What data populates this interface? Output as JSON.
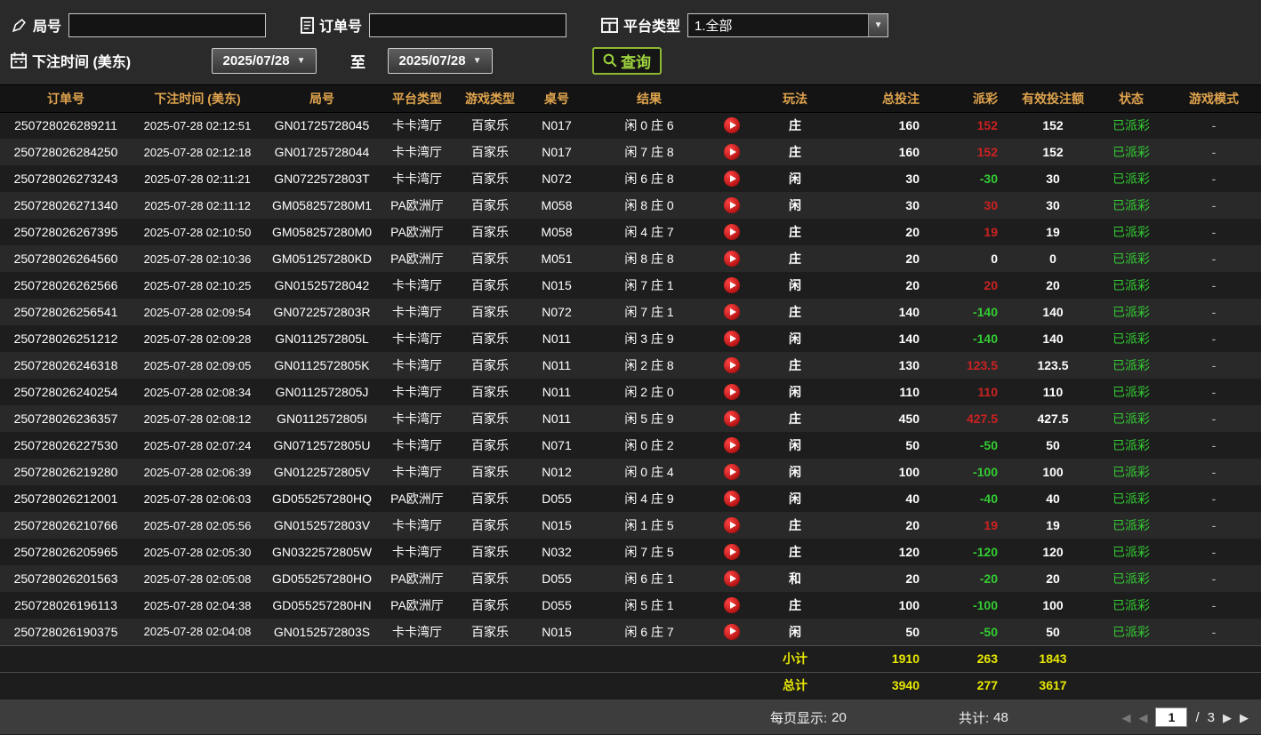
{
  "filters": {
    "round": {
      "label": "局号",
      "value": ""
    },
    "order": {
      "label": "订单号",
      "value": ""
    },
    "platform": {
      "label": "平台类型",
      "value": "1.全部"
    },
    "bet_time": {
      "label": "下注时间 (美东)",
      "from": "2025/07/28",
      "to_label": "至",
      "to": "2025/07/28"
    },
    "query_button": "查询"
  },
  "table": {
    "headers": [
      "订单号",
      "下注时间 (美东)",
      "局号",
      "平台类型",
      "游戏类型",
      "桌号",
      "结果",
      "",
      "玩法",
      "总投注",
      "派彩",
      "有效投注额",
      "状态",
      "游戏模式"
    ],
    "rows": [
      {
        "order_id": "250728026289211",
        "bet_time": "2025-07-28 02:12:51",
        "round_no": "GN01725728045",
        "platform": "卡卡湾厅",
        "game_type": "百家乐",
        "table_no": "N017",
        "result": "闲 0 庄 6",
        "bet_type": "庄",
        "total_bet": "160",
        "payout": "152",
        "payout_color": "win",
        "valid_bet": "152",
        "status": "已派彩",
        "game_mode": "-"
      },
      {
        "order_id": "250728026284250",
        "bet_time": "2025-07-28 02:12:18",
        "round_no": "GN01725728044",
        "platform": "卡卡湾厅",
        "game_type": "百家乐",
        "table_no": "N017",
        "result": "闲 7 庄 8",
        "bet_type": "庄",
        "total_bet": "160",
        "payout": "152",
        "payout_color": "win",
        "valid_bet": "152",
        "status": "已派彩",
        "game_mode": "-"
      },
      {
        "order_id": "250728026273243",
        "bet_time": "2025-07-28 02:11:21",
        "round_no": "GN0722572803T",
        "platform": "卡卡湾厅",
        "game_type": "百家乐",
        "table_no": "N072",
        "result": "闲 6 庄 8",
        "bet_type": "闲",
        "total_bet": "30",
        "payout": "-30",
        "payout_color": "loss",
        "valid_bet": "30",
        "status": "已派彩",
        "game_mode": "-"
      },
      {
        "order_id": "250728026271340",
        "bet_time": "2025-07-28 02:11:12",
        "round_no": "GM058257280M1",
        "platform": "PA欧洲厅",
        "game_type": "百家乐",
        "table_no": "M058",
        "result": "闲 8 庄 0",
        "bet_type": "闲",
        "total_bet": "30",
        "payout": "30",
        "payout_color": "win",
        "valid_bet": "30",
        "status": "已派彩",
        "game_mode": "-"
      },
      {
        "order_id": "250728026267395",
        "bet_time": "2025-07-28 02:10:50",
        "round_no": "GM058257280M0",
        "platform": "PA欧洲厅",
        "game_type": "百家乐",
        "table_no": "M058",
        "result": "闲 4 庄 7",
        "bet_type": "庄",
        "total_bet": "20",
        "payout": "19",
        "payout_color": "win",
        "valid_bet": "19",
        "status": "已派彩",
        "game_mode": "-"
      },
      {
        "order_id": "250728026264560",
        "bet_time": "2025-07-28 02:10:36",
        "round_no": "GM051257280KD",
        "platform": "PA欧洲厅",
        "game_type": "百家乐",
        "table_no": "M051",
        "result": "闲 8 庄 8",
        "bet_type": "庄",
        "total_bet": "20",
        "payout": "0",
        "payout_color": "zero",
        "valid_bet": "0",
        "status": "已派彩",
        "game_mode": "-"
      },
      {
        "order_id": "250728026262566",
        "bet_time": "2025-07-28 02:10:25",
        "round_no": "GN01525728042",
        "platform": "卡卡湾厅",
        "game_type": "百家乐",
        "table_no": "N015",
        "result": "闲 7 庄 1",
        "bet_type": "闲",
        "total_bet": "20",
        "payout": "20",
        "payout_color": "win",
        "valid_bet": "20",
        "status": "已派彩",
        "game_mode": "-"
      },
      {
        "order_id": "250728026256541",
        "bet_time": "2025-07-28 02:09:54",
        "round_no": "GN0722572803R",
        "platform": "卡卡湾厅",
        "game_type": "百家乐",
        "table_no": "N072",
        "result": "闲 7 庄 1",
        "bet_type": "庄",
        "total_bet": "140",
        "payout": "-140",
        "payout_color": "loss",
        "valid_bet": "140",
        "status": "已派彩",
        "game_mode": "-"
      },
      {
        "order_id": "250728026251212",
        "bet_time": "2025-07-28 02:09:28",
        "round_no": "GN0112572805L",
        "platform": "卡卡湾厅",
        "game_type": "百家乐",
        "table_no": "N011",
        "result": "闲 3 庄 9",
        "bet_type": "闲",
        "total_bet": "140",
        "payout": "-140",
        "payout_color": "loss",
        "valid_bet": "140",
        "status": "已派彩",
        "game_mode": "-"
      },
      {
        "order_id": "250728026246318",
        "bet_time": "2025-07-28 02:09:05",
        "round_no": "GN0112572805K",
        "platform": "卡卡湾厅",
        "game_type": "百家乐",
        "table_no": "N011",
        "result": "闲 2 庄 8",
        "bet_type": "庄",
        "total_bet": "130",
        "payout": "123.5",
        "payout_color": "win",
        "valid_bet": "123.5",
        "status": "已派彩",
        "game_mode": "-"
      },
      {
        "order_id": "250728026240254",
        "bet_time": "2025-07-28 02:08:34",
        "round_no": "GN0112572805J",
        "platform": "卡卡湾厅",
        "game_type": "百家乐",
        "table_no": "N011",
        "result": "闲 2 庄 0",
        "bet_type": "闲",
        "total_bet": "110",
        "payout": "110",
        "payout_color": "win",
        "valid_bet": "110",
        "status": "已派彩",
        "game_mode": "-"
      },
      {
        "order_id": "250728026236357",
        "bet_time": "2025-07-28 02:08:12",
        "round_no": "GN0112572805I",
        "platform": "卡卡湾厅",
        "game_type": "百家乐",
        "table_no": "N011",
        "result": "闲 5 庄 9",
        "bet_type": "庄",
        "total_bet": "450",
        "payout": "427.5",
        "payout_color": "win",
        "valid_bet": "427.5",
        "status": "已派彩",
        "game_mode": "-"
      },
      {
        "order_id": "250728026227530",
        "bet_time": "2025-07-28 02:07:24",
        "round_no": "GN0712572805U",
        "platform": "卡卡湾厅",
        "game_type": "百家乐",
        "table_no": "N071",
        "result": "闲 0 庄 2",
        "bet_type": "闲",
        "total_bet": "50",
        "payout": "-50",
        "payout_color": "loss",
        "valid_bet": "50",
        "status": "已派彩",
        "game_mode": "-"
      },
      {
        "order_id": "250728026219280",
        "bet_time": "2025-07-28 02:06:39",
        "round_no": "GN0122572805V",
        "platform": "卡卡湾厅",
        "game_type": "百家乐",
        "table_no": "N012",
        "result": "闲 0 庄 4",
        "bet_type": "闲",
        "total_bet": "100",
        "payout": "-100",
        "payout_color": "loss",
        "valid_bet": "100",
        "status": "已派彩",
        "game_mode": "-"
      },
      {
        "order_id": "250728026212001",
        "bet_time": "2025-07-28 02:06:03",
        "round_no": "GD055257280HQ",
        "platform": "PA欧洲厅",
        "game_type": "百家乐",
        "table_no": "D055",
        "result": "闲 4 庄 9",
        "bet_type": "闲",
        "total_bet": "40",
        "payout": "-40",
        "payout_color": "loss",
        "valid_bet": "40",
        "status": "已派彩",
        "game_mode": "-"
      },
      {
        "order_id": "250728026210766",
        "bet_time": "2025-07-28 02:05:56",
        "round_no": "GN0152572803V",
        "platform": "卡卡湾厅",
        "game_type": "百家乐",
        "table_no": "N015",
        "result": "闲 1 庄 5",
        "bet_type": "庄",
        "total_bet": "20",
        "payout": "19",
        "payout_color": "win",
        "valid_bet": "19",
        "status": "已派彩",
        "game_mode": "-"
      },
      {
        "order_id": "250728026205965",
        "bet_time": "2025-07-28 02:05:30",
        "round_no": "GN0322572805W",
        "platform": "卡卡湾厅",
        "game_type": "百家乐",
        "table_no": "N032",
        "result": "闲 7 庄 5",
        "bet_type": "庄",
        "total_bet": "120",
        "payout": "-120",
        "payout_color": "loss",
        "valid_bet": "120",
        "status": "已派彩",
        "game_mode": "-"
      },
      {
        "order_id": "250728026201563",
        "bet_time": "2025-07-28 02:05:08",
        "round_no": "GD055257280HO",
        "platform": "PA欧洲厅",
        "game_type": "百家乐",
        "table_no": "D055",
        "result": "闲 6 庄 1",
        "bet_type": "和",
        "total_bet": "20",
        "payout": "-20",
        "payout_color": "loss",
        "valid_bet": "20",
        "status": "已派彩",
        "game_mode": "-"
      },
      {
        "order_id": "250728026196113",
        "bet_time": "2025-07-28 02:04:38",
        "round_no": "GD055257280HN",
        "platform": "PA欧洲厅",
        "game_type": "百家乐",
        "table_no": "D055",
        "result": "闲 5 庄 1",
        "bet_type": "庄",
        "total_bet": "100",
        "payout": "-100",
        "payout_color": "loss",
        "valid_bet": "100",
        "status": "已派彩",
        "game_mode": "-"
      },
      {
        "order_id": "250728026190375",
        "bet_time": "2025-07-28 02:04:08",
        "round_no": "GN0152572803S",
        "platform": "卡卡湾厅",
        "game_type": "百家乐",
        "table_no": "N015",
        "result": "闲 6 庄 7",
        "bet_type": "闲",
        "total_bet": "50",
        "payout": "-50",
        "payout_color": "loss",
        "valid_bet": "50",
        "status": "已派彩",
        "game_mode": "-"
      }
    ],
    "subtotal": {
      "label": "小计",
      "total_bet": "1910",
      "payout": "263",
      "valid_bet": "1843"
    },
    "total": {
      "label": "总计",
      "total_bet": "3940",
      "payout": "277",
      "valid_bet": "3617"
    }
  },
  "pagination": {
    "per_page_label": "每页显示:",
    "per_page_value": "20",
    "total_label": "共计:",
    "total_value": "48",
    "current_page": "1",
    "separator": "/",
    "total_pages": "3"
  },
  "colors": {
    "win": "#cc2222",
    "loss": "#33cc33",
    "status": "#33cc33",
    "summary_yellow": "#e8e800",
    "header_text": "#e0a44e",
    "accent_green": "#9ed43e"
  }
}
